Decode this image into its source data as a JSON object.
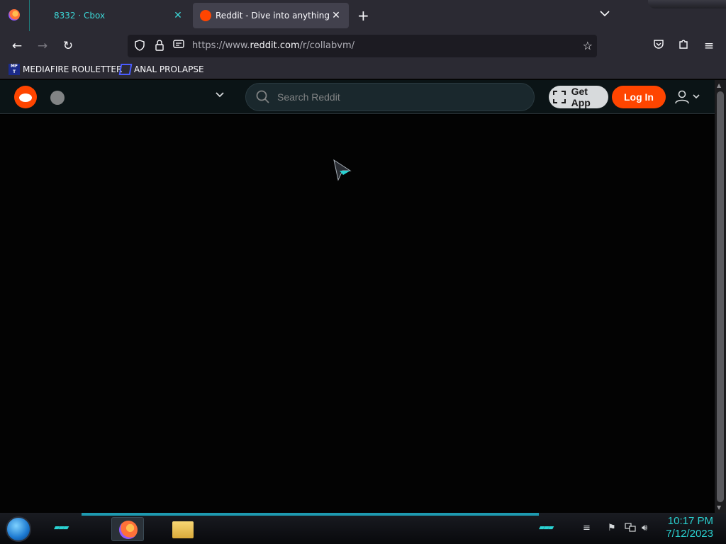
{
  "browser": {
    "tabs": [
      {
        "title": "8332 · Cbox",
        "active": false
      },
      {
        "title": "Reddit - Dive into anything",
        "active": true
      }
    ],
    "url_prefix": "https://www.",
    "url_host": "reddit.com",
    "url_path": "/r/collabvm/",
    "bookmarks": [
      {
        "label": "MEDIAFIRE ROULETTER",
        "icon": "mf-icon",
        "icon_text": "MF T"
      },
      {
        "label": "ANAL PROLAPSE",
        "icon": "sigma-icon"
      }
    ]
  },
  "reddit": {
    "search_placeholder": "Search Reddit",
    "get_app_label": "Get App",
    "login_label": "Log In",
    "accent": "#ff4500"
  },
  "taskbar": {
    "time": "10:17 PM",
    "date": "7/12/2023",
    "accent": "#2ad2d2"
  }
}
